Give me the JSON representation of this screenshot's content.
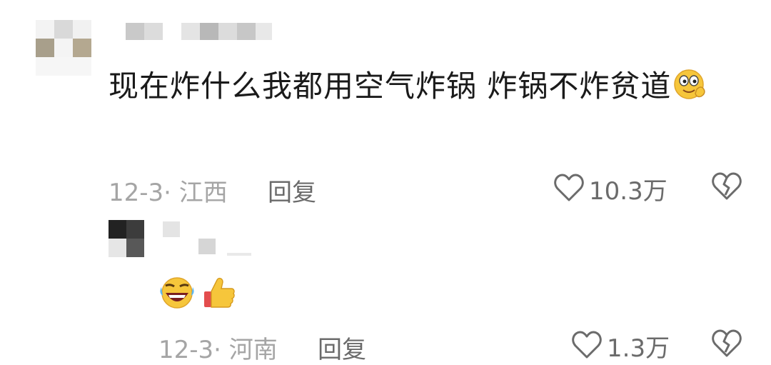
{
  "comment": {
    "text": "现在炸什么我都用空气炸锅 炸锅不炸贫道",
    "emoji": "smiling-face-with-hand-emoji",
    "meta": "12-3· 江西",
    "reply_label": "回复",
    "likes": "10.3万"
  },
  "reply": {
    "emojis": [
      "rolling-on-floor-laughing-emoji",
      "thumbs-up-emoji"
    ],
    "meta": "12-3· 河南",
    "reply_label": "回复",
    "likes": "1.3万"
  },
  "colors": {
    "text": "#1a1a1a",
    "meta": "#a5a5a5",
    "action": "#6b6b6b"
  },
  "icons": [
    "heart-outline-icon",
    "broken-heart-icon"
  ]
}
